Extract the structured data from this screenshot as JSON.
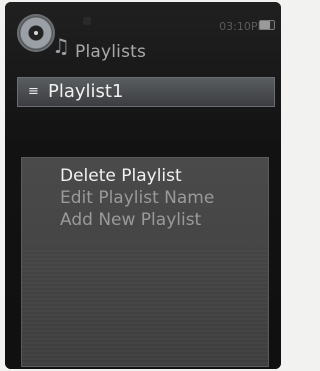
{
  "header": {
    "title": "Playlists",
    "status_time": "03:10PM"
  },
  "list": {
    "items": [
      {
        "label": "Playlist1"
      }
    ]
  },
  "menu": {
    "items": [
      {
        "label": "Delete Playlist",
        "state": "selected"
      },
      {
        "label": "Edit Playlist Name",
        "state": "normal"
      },
      {
        "label": "Add New Playlist",
        "state": "normal"
      }
    ]
  },
  "icons": {
    "app": "music-player-icon",
    "title_note": "music-note-icon",
    "list_item": "playlist-icon",
    "battery": "battery-icon"
  }
}
